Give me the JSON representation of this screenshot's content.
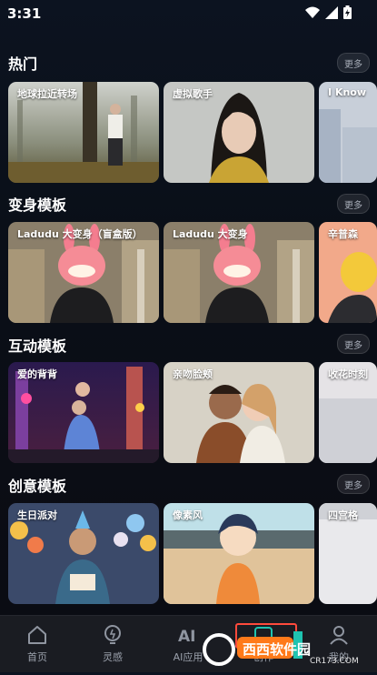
{
  "status": {
    "time": "3:31"
  },
  "sections": [
    {
      "title": "热门",
      "more": "更多",
      "cards": [
        "地球拉近转场",
        "虚拟歌手",
        "I Know"
      ]
    },
    {
      "title": "变身模板",
      "more": "更多",
      "cards": [
        "Ladudu 大变身（盲盒版）",
        "Ladudu 大变身",
        "辛普森"
      ]
    },
    {
      "title": "互动模板",
      "more": "更多",
      "cards": [
        "爱的背背",
        "亲吻脸颊",
        "收花时刻"
      ]
    },
    {
      "title": "创意模板",
      "more": "更多",
      "cards": [
        "生日派对",
        "像素风",
        "四宫格"
      ]
    }
  ],
  "tabbar": {
    "tabs": [
      {
        "label": "首页",
        "icon": "home-icon"
      },
      {
        "label": "灵感",
        "icon": "lightbulb-icon"
      },
      {
        "label": "AI应用",
        "icon": "ai-icon"
      },
      {
        "label": "创作",
        "icon": "create-icon"
      },
      {
        "label": "我的",
        "icon": "profile-icon"
      }
    ]
  },
  "watermark": {
    "brand": "西西软件园",
    "url": "CR173.COM"
  },
  "colors": {
    "background": "#0b0f18",
    "tabbar": "#1a1c22",
    "accent_highlight": "#ff4a3c",
    "watermark_orange": "#ff7a1a",
    "watermark_teal": "#1ec3b0"
  }
}
